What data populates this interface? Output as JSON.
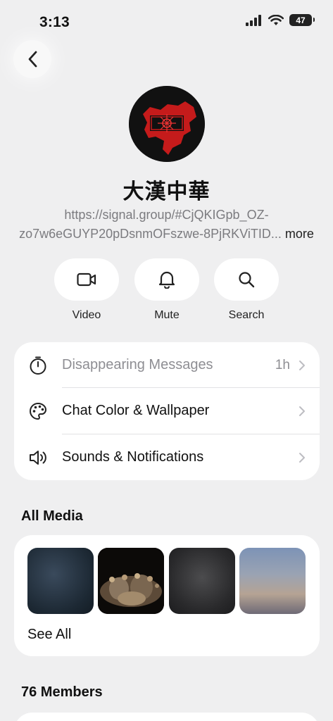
{
  "status_bar": {
    "time": "3:13",
    "battery": "47"
  },
  "group": {
    "name": "大漢中華",
    "link_line1": "https://signal.group/#CjQKIGpb_OZ-",
    "link_line2": "zo7w6eGUYP20pDsnmOFszwe-8PjRKViTID...",
    "more": "more"
  },
  "actions": [
    {
      "label": "Video",
      "icon": "video-icon"
    },
    {
      "label": "Mute",
      "icon": "bell-icon"
    },
    {
      "label": "Search",
      "icon": "search-icon"
    }
  ],
  "settings": [
    {
      "label": "Disappearing Messages",
      "value": "1h",
      "icon": "timer-icon"
    },
    {
      "label": "Chat Color & Wallpaper",
      "value": "",
      "icon": "palette-icon"
    },
    {
      "label": "Sounds & Notifications",
      "value": "",
      "icon": "speaker-icon"
    }
  ],
  "media": {
    "title": "All Media",
    "see_all": "See All"
  },
  "members": {
    "title": "76 Members"
  },
  "colors": {
    "background": "#efeff0",
    "card": "#ffffff",
    "secondary_text": "#7b7b7f",
    "avatar_red": "#c51b1b"
  }
}
